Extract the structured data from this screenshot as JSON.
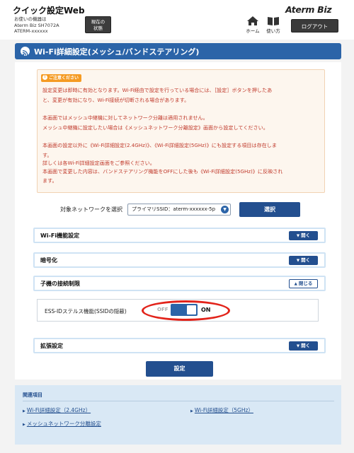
{
  "header": {
    "app_title": "クイック設定Web",
    "device_line1": "お使いの機器は",
    "device_line2": "Aterm Biz SH7072A",
    "device_line3": "ATERM-xxxxxx",
    "status_line1": "現在の",
    "status_line2": "状態",
    "brand": "Aterm Biz",
    "home_label": "ホーム",
    "manual_label": "使い方",
    "logout_label": "ログアウト"
  },
  "page": {
    "title": "Wi-Fi詳細設定(メッシュ/バンドステアリング)"
  },
  "notice": {
    "badge": "ご注意ください",
    "lines": [
      "設定変更は即時に有効となります。Wi-Fi経由で設定を行っている場合には、［設定］ボタンを押したあ",
      "と、変更が有効になり、Wi-Fi接続が切断される場合があります。",
      "本画面ではメッシュ中継機に対してネットワーク分離は適用されません。",
      "メッシュ中継機に設定したい場合は《メッシュネットワーク分離設定》画面から設定してください。",
      "本画面の設定以外に《Wi-Fi詳細設定(2.4GHz)》、《Wi-Fi詳細設定(5GHz)》にも設定する項目は存在しま",
      "す。",
      "詳しくは各Wi-Fi詳細設定画面をご参照ください。",
      "本画面で変更した内容は、バンドステアリング機能をOFFにした後も《Wi-Fi詳細設定(5GHz)》に反映され",
      "ます。"
    ]
  },
  "network": {
    "label": "対象ネットワークを選択",
    "selected": "プライマリSSID：aterm-xxxxxx-5p",
    "select_button": "選択"
  },
  "sections": {
    "wifi_func": {
      "title": "Wi-Fi機能設定",
      "button": "開く"
    },
    "encryption": {
      "title": "暗号化",
      "button": "開く"
    },
    "conn_limit": {
      "title": "子機の接続制限",
      "button": "閉じる"
    },
    "extended": {
      "title": "拡張設定",
      "button": "開く"
    }
  },
  "conn_limit_body": {
    "label": "ESS-IDステルス機能(SSIDの隠蔽)",
    "toggle_off": "OFF",
    "toggle_on": "ON",
    "state": "on"
  },
  "save_button": "設定",
  "related": {
    "title": "関連項目",
    "links": [
      "Wi-Fi詳細設定（2.4GHz）",
      "Wi-Fi詳細設定（5GHz）",
      "メッシュネットワーク分離設定"
    ]
  },
  "colors": {
    "primary": "#234f8f",
    "title_bar": "#2b64a8",
    "notice_text": "#c0392b",
    "highlight_ring": "#e2231a"
  },
  "icons": {
    "home": "home-icon",
    "manual": "book-icon",
    "wifi": "wifi-icon",
    "chevron": "chevron-down-icon"
  }
}
